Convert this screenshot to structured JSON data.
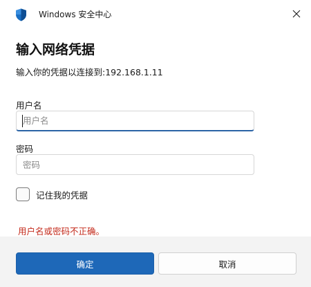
{
  "window": {
    "title": "Windows 安全中心",
    "app_icon": "shield-icon",
    "close_icon": "close-icon"
  },
  "dialog": {
    "heading": "输入网络凭据",
    "subheading": "输入你的凭据以连接到:192.168.1.11"
  },
  "form": {
    "username_label": "用户名",
    "username_value": "",
    "username_placeholder": "用户名",
    "password_label": "密码",
    "password_value": "",
    "password_placeholder": "密码",
    "remember_label": "记住我的凭据",
    "remember_checked": false
  },
  "error_message": "用户名或密码不正确。",
  "buttons": {
    "ok": "确定",
    "cancel": "取消"
  },
  "colors": {
    "accent": "#1e68b8",
    "error": "#c42b1c",
    "footer_bg": "#f3f3f3"
  }
}
